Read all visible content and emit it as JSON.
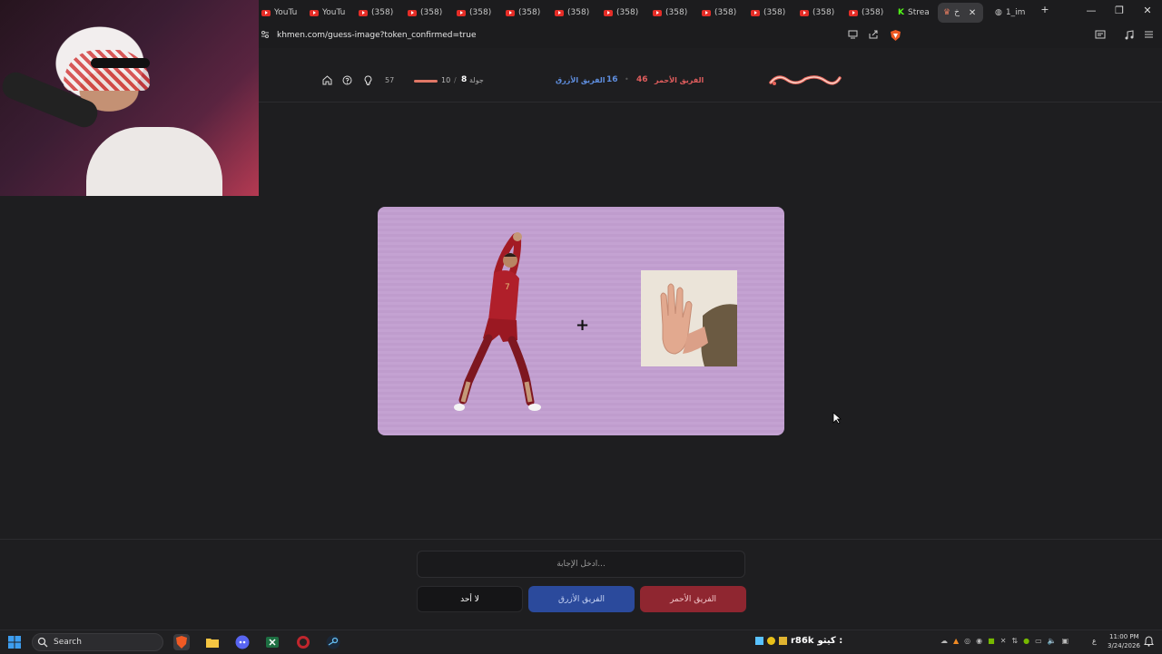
{
  "browser": {
    "tabs": [
      {
        "label": "YouTu",
        "icon": "youtube-icon"
      },
      {
        "label": "YouTu",
        "icon": "youtube-icon"
      },
      {
        "label": "(358)",
        "icon": "youtube-icon"
      },
      {
        "label": "(358)",
        "icon": "youtube-icon"
      },
      {
        "label": "(358)",
        "icon": "youtube-icon"
      },
      {
        "label": "(358)",
        "icon": "youtube-icon"
      },
      {
        "label": "(358)",
        "icon": "youtube-icon"
      },
      {
        "label": "(358)",
        "icon": "youtube-icon"
      },
      {
        "label": "(358)",
        "icon": "youtube-icon"
      },
      {
        "label": "(358)",
        "icon": "youtube-icon"
      },
      {
        "label": "(358)",
        "icon": "youtube-icon"
      },
      {
        "label": "(358)",
        "icon": "youtube-icon"
      },
      {
        "label": "(358)",
        "icon": "youtube-icon"
      },
      {
        "label": "Strea",
        "icon": "kick-icon"
      },
      {
        "label": "خ",
        "icon": "site-icon"
      },
      {
        "label": "1_im",
        "icon": "globe-icon"
      }
    ],
    "new_tab": "+",
    "url": "khmen.com/guess-image?token_confirmed=true",
    "window_controls": {
      "minimize": "—",
      "restore": "❐",
      "close": "✕"
    }
  },
  "game": {
    "timer": "57",
    "round_total": "10",
    "round_separator": "/",
    "round_number": "8",
    "round_label": "جولة",
    "blue_team_label": "الفريق الأزرق",
    "blue_team_score": "16",
    "score_separator": "•",
    "red_team_score": "46",
    "red_team_label": "الفريق الأحمر",
    "progress_fraction": 0.8,
    "colors": {
      "red": "#e05d5d",
      "blue": "#5f8fe0",
      "card_bg": "#c4a2d2"
    },
    "puzzle_operator": "+"
  },
  "answer": {
    "placeholder": "أدخل الإجابة...",
    "btn_none": "لا أحد",
    "btn_blue": "الفريق الأزرق",
    "btn_red": "الفريق الأحمر"
  },
  "taskbar": {
    "search_label": "Search",
    "stream_user": "r86k",
    "stream_name": "كيثو :",
    "lang": "ع",
    "time": "11:00 PM",
    "date": "3/24/2026"
  }
}
